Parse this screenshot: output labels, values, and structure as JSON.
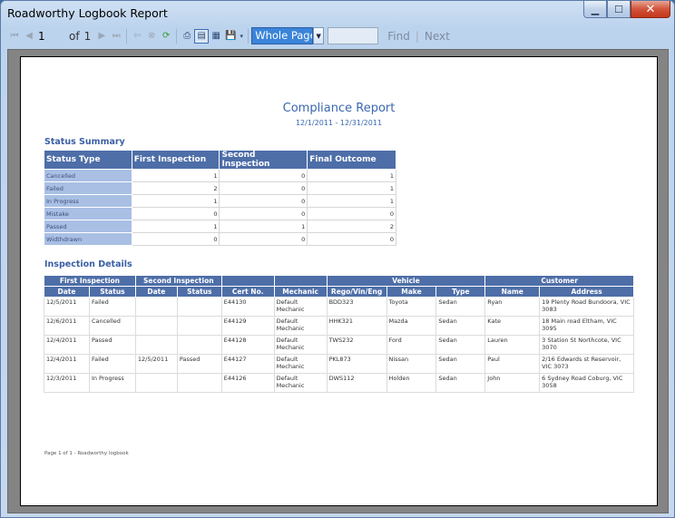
{
  "window": {
    "title": "Roadworthy Logbook Report"
  },
  "toolbar": {
    "page_current": "1",
    "page_of_label": "of",
    "page_total": "1",
    "zoom_value": "Whole Page",
    "find_label": "Find",
    "next_label": "Next"
  },
  "report": {
    "title": "Compliance Report",
    "range": "12/1/2011 - 12/31/2011",
    "summary_heading": "Status Summary",
    "summary_headers": [
      "Status Type",
      "First Inspection",
      "Second Inspection",
      "Final Outcome"
    ],
    "summary_rows": [
      [
        "Cancelled",
        "1",
        "0",
        "1"
      ],
      [
        "Failed",
        "2",
        "0",
        "1"
      ],
      [
        "In Progress",
        "1",
        "0",
        "1"
      ],
      [
        "Mistake",
        "0",
        "0",
        "0"
      ],
      [
        "Passed",
        "1",
        "1",
        "2"
      ],
      [
        "Widthdrawn",
        "0",
        "0",
        "0"
      ]
    ],
    "details_heading": "Inspection Details",
    "details_group_headers": {
      "first_inspection": "First Inspection",
      "second_inspection": "Second Inspection",
      "vehicle": "Vehicle",
      "customer": "Customer"
    },
    "details_headers": [
      "Date",
      "Status",
      "Date",
      "Status",
      "Cert No.",
      "Mechanic",
      "Rego/Vin/Eng",
      "Make",
      "Type",
      "Name",
      "Address"
    ],
    "details_rows": [
      [
        "12/5/2011",
        "Failed",
        "",
        "",
        "E44130",
        "Default Mechanic",
        "BDD323",
        "Toyota",
        "Sedan",
        "Ryan",
        "19 Plenty Road Bundoora, VIC 3083"
      ],
      [
        "12/6/2011",
        "Cancelled",
        "",
        "",
        "E44129",
        "Default Mechanic",
        "HHK321",
        "Mazda",
        "Sedan",
        "Kate",
        "18 Main road Eltham, VIC 3095"
      ],
      [
        "12/4/2011",
        "Passed",
        "",
        "",
        "E44128",
        "Default Mechanic",
        "TWS232",
        "Ford",
        "Sedan",
        "Lauren",
        "3 Station St Northcote, VIC 3070"
      ],
      [
        "12/4/2011",
        "Failed",
        "12/5/2011",
        "Passed",
        "E44127",
        "Default Mechanic",
        "PKL873",
        "Nissan",
        "Sedan",
        "Paul",
        "2/16 Edwards st Reservoir, VIC 3073"
      ],
      [
        "12/3/2011",
        "In Progress",
        "",
        "",
        "E44126",
        "Default Mechanic",
        "DWS112",
        "Holden",
        "Sedan",
        "John",
        "6 Sydney Road Coburg, VIC 3058"
      ]
    ],
    "footer": "Page 1 of 1 - Roadworthy logbook"
  }
}
